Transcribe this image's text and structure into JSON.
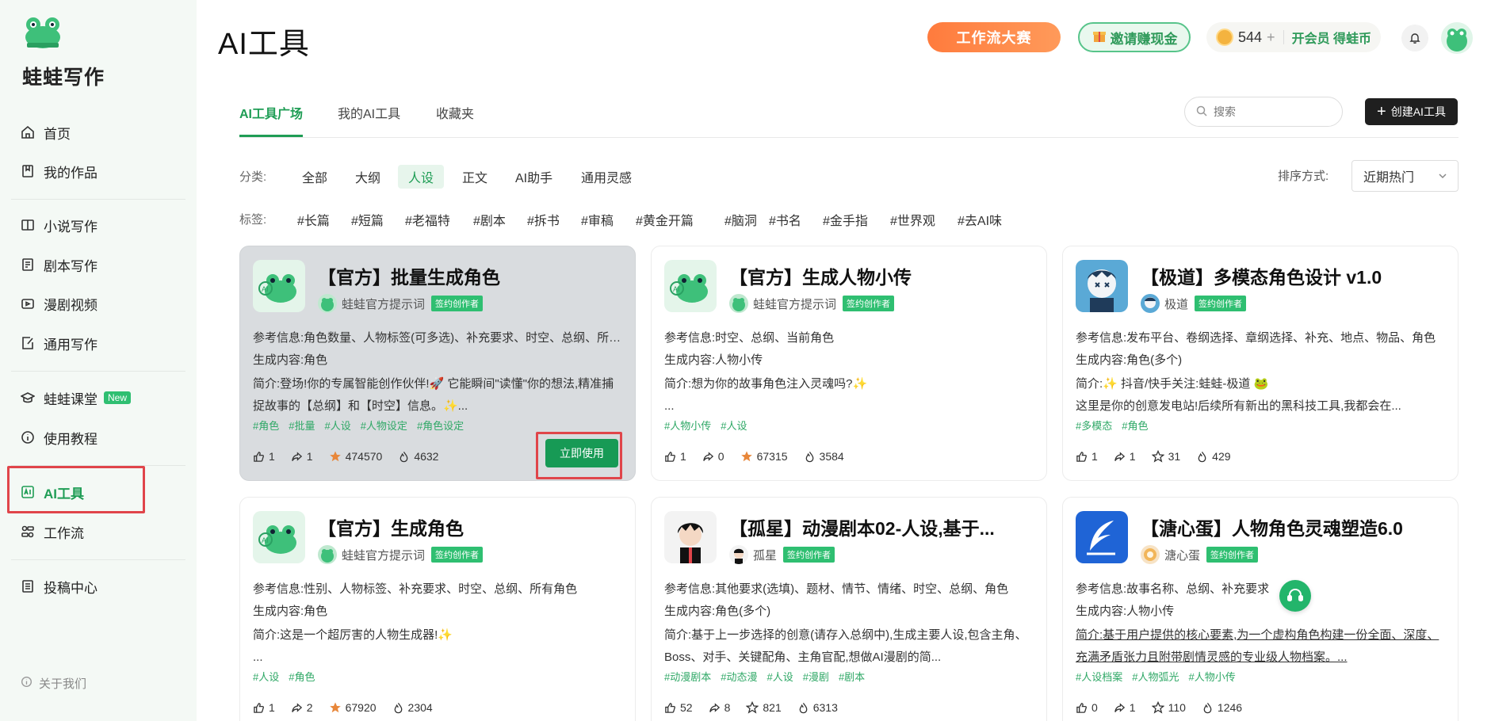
{
  "app": {
    "brand": "蛙蛙写作",
    "page_title": "AI工具"
  },
  "sidebar": {
    "items": [
      {
        "label": "首页",
        "icon": "home-icon"
      },
      {
        "label": "我的作品",
        "icon": "book-icon"
      },
      {
        "label": "小说写作",
        "icon": "open-book-icon"
      },
      {
        "label": "剧本写作",
        "icon": "script-icon"
      },
      {
        "label": "漫剧视频",
        "icon": "video-icon"
      },
      {
        "label": "通用写作",
        "icon": "edit-doc-icon"
      },
      {
        "label": "蛙蛙课堂",
        "icon": "graduation-cap-icon",
        "badge": "New"
      },
      {
        "label": "使用教程",
        "icon": "info-icon"
      },
      {
        "label": "AI工具",
        "icon": "ai-tool-icon",
        "active": true
      },
      {
        "label": "工作流",
        "icon": "workflow-icon"
      },
      {
        "label": "投稿中心",
        "icon": "submit-icon"
      }
    ],
    "about": "关于我们"
  },
  "header": {
    "contest": "工作流大赛",
    "invite": "邀请赚现金",
    "coins": "544",
    "coins_plus": "+",
    "vip": "开会员 得蛙币"
  },
  "tabs": [
    {
      "label": "AI工具广场",
      "active": true
    },
    {
      "label": "我的AI工具"
    },
    {
      "label": "收藏夹"
    }
  ],
  "search": {
    "placeholder": "搜索"
  },
  "create_button": "创建AI工具",
  "filters": {
    "category_label": "分类:",
    "categories": [
      "全部",
      "大纲",
      "人设",
      "正文",
      "AI助手",
      "通用灵感"
    ],
    "active_category": "人设",
    "tag_label": "标签:",
    "tags": [
      "#长篇",
      "#短篇",
      "#老福特",
      "#剧本",
      "#拆书",
      "#审稿",
      "#黄金开篇",
      "#脑洞",
      "#书名",
      "#金手指",
      "#世界观",
      "#去AI味"
    ],
    "sort_label": "排序方式:",
    "sort_value": "近期热门"
  },
  "cards": [
    {
      "title": "【官方】批量生成角色",
      "author": "蛙蛙官方提示词",
      "signed": "签约创作者",
      "ref": "参考信息:角色数量、人物标签(可多选)、补充要求、时空、总纲、所有角色",
      "gen": "生成内容:角色",
      "intro": "简介:登场!你的专属智能创作伙伴!🚀 它能瞬间\"读懂\"你的想法,精准捕捉故事的【总纲】和【时空】信息。✨...",
      "tags": [
        "#角色",
        "#批量",
        "#人设",
        "#人物设定",
        "#角色设定"
      ],
      "likes": "1",
      "shares": "1",
      "stars": "474570",
      "uses": "4632",
      "starred": true,
      "use_button": "立即使用"
    },
    {
      "title": "【官方】生成人物小传",
      "author": "蛙蛙官方提示词",
      "signed": "签约创作者",
      "ref": "参考信息:时空、总纲、当前角色",
      "gen": "生成内容:人物小传",
      "intro": "简介:想为你的故事角色注入灵魂吗?✨\n...",
      "tags": [
        "#人物小传",
        "#人设"
      ],
      "likes": "1",
      "shares": "0",
      "stars": "67315",
      "uses": "3584",
      "starred": true
    },
    {
      "title": "【极道】多模态角色设计 v1.0",
      "author": "极道",
      "signed": "签约创作者",
      "ref": "参考信息:发布平台、卷纲选择、章纲选择、补充、地点、物品、角色",
      "gen": "生成内容:角色(多个)",
      "intro": "简介:✨ 抖音/快手关注:蛙蛙-极道 🐸\n这里是你的创意发电站!后续所有新出的黑科技工具,我都会在...",
      "tags": [
        "#多模态",
        "#角色"
      ],
      "likes": "1",
      "shares": "1",
      "stars": "31",
      "uses": "429",
      "starred": false
    },
    {
      "title": "【官方】生成角色",
      "author": "蛙蛙官方提示词",
      "signed": "签约创作者",
      "ref": "参考信息:性别、人物标签、补充要求、时空、总纲、所有角色",
      "gen": "生成内容:角色",
      "intro": "简介:这是一个超厉害的人物生成器!✨\n...",
      "tags": [
        "#人设",
        "#角色"
      ],
      "likes": "1",
      "shares": "2",
      "stars": "67920",
      "uses": "2304",
      "starred": true
    },
    {
      "title": "【孤星】动漫剧本02-人设,基于...",
      "author": "孤星",
      "signed": "签约创作者",
      "ref": "参考信息:其他要求(选填)、题材、情节、情绪、时空、总纲、角色",
      "gen": "生成内容:角色(多个)",
      "intro": "简介:基于上一步选择的创意(请存入总纲中),生成主要人设,包含主角、Boss、对手、关键配角、主角官配,想做AI漫剧的简...",
      "tags": [
        "#动漫剧本",
        "#动态漫",
        "#人设",
        "#漫剧",
        "#剧本"
      ],
      "likes": "52",
      "shares": "8",
      "stars": "821",
      "uses": "6313",
      "starred": false
    },
    {
      "title": "【溏心蛋】人物角色灵魂塑造6.0",
      "author": "溏心蛋",
      "signed": "签约创作者",
      "ref": "参考信息:故事名称、总纲、补充要求",
      "gen": "生成内容:人物小传",
      "intro": "简介:基于用户提供的核心要素,为一个虚构角色构建一份全面、深度、充满矛盾张力且附带剧情灵感的专业级人物档案。...",
      "tags": [
        "#人设档案",
        "#人物弧光",
        "#人物小传"
      ],
      "likes": "0",
      "shares": "1",
      "stars": "110",
      "uses": "1246",
      "starred": false
    }
  ],
  "colors": {
    "accent": "#1f9d55",
    "highlight": "#e0454a",
    "star": "#e8873a"
  }
}
